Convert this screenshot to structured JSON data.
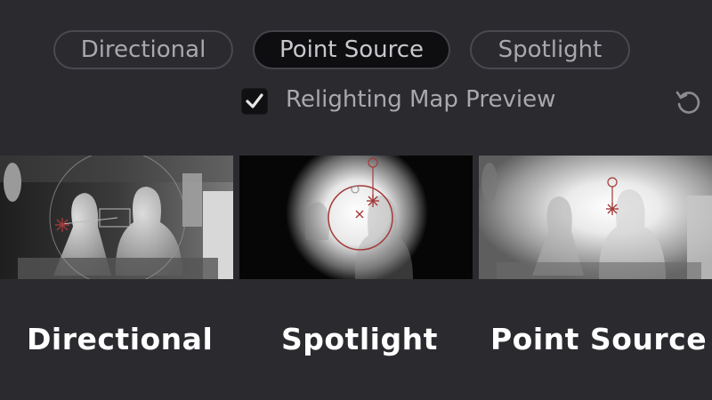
{
  "light_mode_tabs": [
    {
      "label": "Directional",
      "active": false
    },
    {
      "label": "Point Source",
      "active": true
    },
    {
      "label": "Spotlight",
      "active": false
    }
  ],
  "relighting_preview": {
    "label": "Relighting Map Preview",
    "checked": true
  },
  "icons": {
    "checkbox": "checkmark-icon",
    "reset": "reset-icon"
  },
  "captions": {
    "directional": "Directional",
    "spotlight": "Spotlight",
    "point_source": "Point Source"
  },
  "colors": {
    "background": "#2b2a2f",
    "accent_marker": "#a33a3a",
    "caption_text": "#ffffff"
  }
}
